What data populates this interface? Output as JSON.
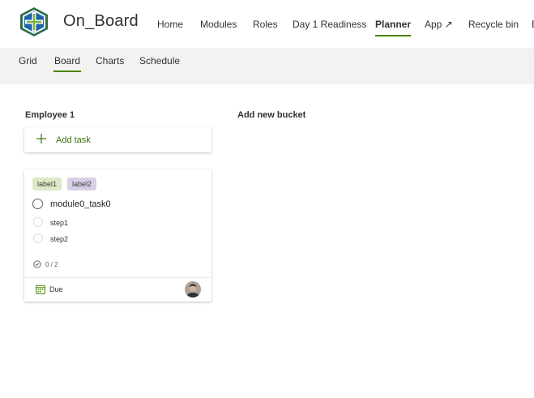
{
  "header": {
    "app_title": "On_Board",
    "nav": [
      {
        "label": "Home"
      },
      {
        "label": "Modules"
      },
      {
        "label": "Roles"
      },
      {
        "label": "Day 1 Readiness"
      },
      {
        "label": "Planner",
        "active": true
      },
      {
        "label": "App ↗"
      },
      {
        "label": "Recycle bin"
      },
      {
        "label": "E"
      }
    ]
  },
  "subnav": {
    "tabs": [
      {
        "label": "Grid"
      },
      {
        "label": "Board",
        "active": true
      },
      {
        "label": "Charts"
      },
      {
        "label": "Schedule"
      }
    ]
  },
  "board": {
    "bucket": {
      "title": "Employee 1",
      "add_task_label": "Add task",
      "card": {
        "labels": [
          "label1",
          "label2"
        ],
        "task_name": "module0_task0",
        "steps": [
          "step1",
          "step2"
        ],
        "checklist_progress": "0 / 2",
        "due_label": "Due",
        "avatar_icon": "user-avatar"
      }
    },
    "add_bucket_label": "Add new bucket"
  },
  "colors": {
    "accent": "#498205",
    "label1_bg": "#dbebc7",
    "label2_bg": "#d8cfe8",
    "subbar_bg": "#f3f2f1"
  }
}
